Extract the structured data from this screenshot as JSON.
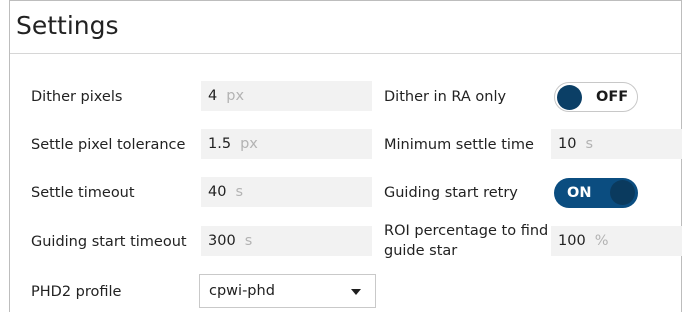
{
  "settings": {
    "title": "Settings",
    "dither_pixels": {
      "label": "Dither pixels",
      "value": "4",
      "unit": "px"
    },
    "settle_pixel_tolerance": {
      "label": "Settle pixel tolerance",
      "value": "1.5",
      "unit": "px"
    },
    "settle_timeout": {
      "label": "Settle timeout",
      "value": "40",
      "unit": "s"
    },
    "guiding_start_timeout": {
      "label": "Guiding start timeout",
      "value": "300",
      "unit": "s"
    },
    "phd2_profile": {
      "label": "PHD2 profile",
      "value": "cpwi-phd"
    },
    "dither_ra_only": {
      "label": "Dither in RA only",
      "state": "OFF"
    },
    "minimum_settle_time": {
      "label": "Minimum settle time",
      "value": "10",
      "unit": "s"
    },
    "guiding_start_retry": {
      "label": "Guiding start retry",
      "state": "ON"
    },
    "roi_percentage": {
      "label": "ROI percentage to find guide star",
      "value": "100",
      "unit": "%"
    },
    "colors": {
      "toggle_on": "#0b4d80",
      "toggle_knob": "#0b3f66",
      "field_bg": "#f2f2f2"
    }
  }
}
